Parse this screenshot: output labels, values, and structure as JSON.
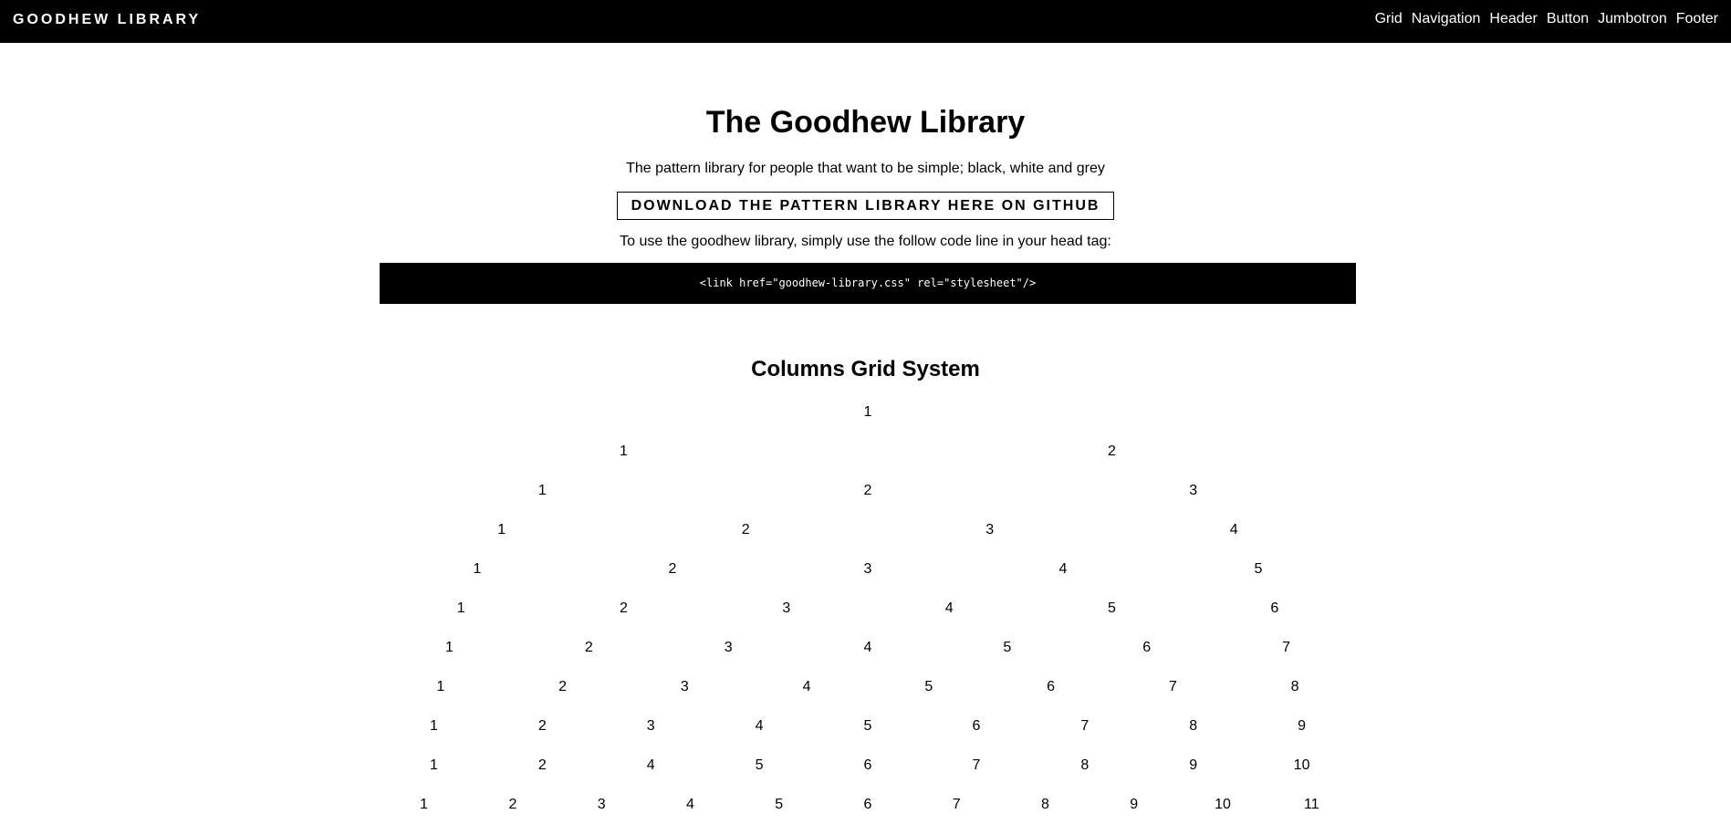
{
  "header": {
    "brand": "GOODHEW LIBRARY",
    "nav": [
      "Grid",
      "Navigation",
      "Header",
      "Button",
      "Jumbotron",
      "Footer"
    ]
  },
  "hero": {
    "title": "The Goodhew Library",
    "tagline": "The pattern library for people that want to be simple; black, white and grey",
    "download_label": "DOWNLOAD THE PATTERN LIBRARY HERE ON GITHUB",
    "usage_text": "To use the goodhew library, simply use the follow code line in your head tag:",
    "code_line": "<link href=\"goodhew-library.css\" rel=\"stylesheet\"/>"
  },
  "grid_section": {
    "title": "Columns Grid System",
    "rows": [
      [
        "1"
      ],
      [
        "1",
        "2"
      ],
      [
        "1",
        "2",
        "3"
      ],
      [
        "1",
        "2",
        "3",
        "4"
      ],
      [
        "1",
        "2",
        "3",
        "4",
        "5"
      ],
      [
        "1",
        "2",
        "3",
        "4",
        "5",
        "6"
      ],
      [
        "1",
        "2",
        "3",
        "4",
        "5",
        "6",
        "7"
      ],
      [
        "1",
        "2",
        "3",
        "4",
        "5",
        "6",
        "7",
        "8"
      ],
      [
        "1",
        "2",
        "3",
        "4",
        "5",
        "6",
        "7",
        "8",
        "9"
      ],
      [
        "1",
        "2",
        "4",
        "5",
        "6",
        "7",
        "8",
        "9",
        "10"
      ],
      [
        "1",
        "2",
        "3",
        "4",
        "5",
        "6",
        "7",
        "8",
        "9",
        "10",
        "11"
      ]
    ]
  },
  "colors": {
    "background": "#ffffff",
    "text": "#000000",
    "bar": "#000000"
  }
}
